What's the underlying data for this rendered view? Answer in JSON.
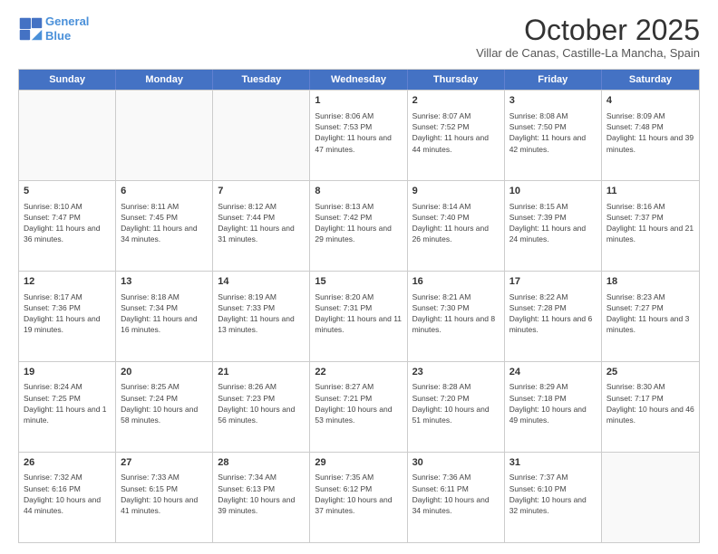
{
  "header": {
    "logo_line1": "General",
    "logo_line2": "Blue",
    "month_title": "October 2025",
    "location": "Villar de Canas, Castille-La Mancha, Spain"
  },
  "days_of_week": [
    "Sunday",
    "Monday",
    "Tuesday",
    "Wednesday",
    "Thursday",
    "Friday",
    "Saturday"
  ],
  "rows": [
    [
      {
        "day": "",
        "content": ""
      },
      {
        "day": "",
        "content": ""
      },
      {
        "day": "",
        "content": ""
      },
      {
        "day": "1",
        "content": "Sunrise: 8:06 AM\nSunset: 7:53 PM\nDaylight: 11 hours and 47 minutes."
      },
      {
        "day": "2",
        "content": "Sunrise: 8:07 AM\nSunset: 7:52 PM\nDaylight: 11 hours and 44 minutes."
      },
      {
        "day": "3",
        "content": "Sunrise: 8:08 AM\nSunset: 7:50 PM\nDaylight: 11 hours and 42 minutes."
      },
      {
        "day": "4",
        "content": "Sunrise: 8:09 AM\nSunset: 7:48 PM\nDaylight: 11 hours and 39 minutes."
      }
    ],
    [
      {
        "day": "5",
        "content": "Sunrise: 8:10 AM\nSunset: 7:47 PM\nDaylight: 11 hours and 36 minutes."
      },
      {
        "day": "6",
        "content": "Sunrise: 8:11 AM\nSunset: 7:45 PM\nDaylight: 11 hours and 34 minutes."
      },
      {
        "day": "7",
        "content": "Sunrise: 8:12 AM\nSunset: 7:44 PM\nDaylight: 11 hours and 31 minutes."
      },
      {
        "day": "8",
        "content": "Sunrise: 8:13 AM\nSunset: 7:42 PM\nDaylight: 11 hours and 29 minutes."
      },
      {
        "day": "9",
        "content": "Sunrise: 8:14 AM\nSunset: 7:40 PM\nDaylight: 11 hours and 26 minutes."
      },
      {
        "day": "10",
        "content": "Sunrise: 8:15 AM\nSunset: 7:39 PM\nDaylight: 11 hours and 24 minutes."
      },
      {
        "day": "11",
        "content": "Sunrise: 8:16 AM\nSunset: 7:37 PM\nDaylight: 11 hours and 21 minutes."
      }
    ],
    [
      {
        "day": "12",
        "content": "Sunrise: 8:17 AM\nSunset: 7:36 PM\nDaylight: 11 hours and 19 minutes."
      },
      {
        "day": "13",
        "content": "Sunrise: 8:18 AM\nSunset: 7:34 PM\nDaylight: 11 hours and 16 minutes."
      },
      {
        "day": "14",
        "content": "Sunrise: 8:19 AM\nSunset: 7:33 PM\nDaylight: 11 hours and 13 minutes."
      },
      {
        "day": "15",
        "content": "Sunrise: 8:20 AM\nSunset: 7:31 PM\nDaylight: 11 hours and 11 minutes."
      },
      {
        "day": "16",
        "content": "Sunrise: 8:21 AM\nSunset: 7:30 PM\nDaylight: 11 hours and 8 minutes."
      },
      {
        "day": "17",
        "content": "Sunrise: 8:22 AM\nSunset: 7:28 PM\nDaylight: 11 hours and 6 minutes."
      },
      {
        "day": "18",
        "content": "Sunrise: 8:23 AM\nSunset: 7:27 PM\nDaylight: 11 hours and 3 minutes."
      }
    ],
    [
      {
        "day": "19",
        "content": "Sunrise: 8:24 AM\nSunset: 7:25 PM\nDaylight: 11 hours and 1 minute."
      },
      {
        "day": "20",
        "content": "Sunrise: 8:25 AM\nSunset: 7:24 PM\nDaylight: 10 hours and 58 minutes."
      },
      {
        "day": "21",
        "content": "Sunrise: 8:26 AM\nSunset: 7:23 PM\nDaylight: 10 hours and 56 minutes."
      },
      {
        "day": "22",
        "content": "Sunrise: 8:27 AM\nSunset: 7:21 PM\nDaylight: 10 hours and 53 minutes."
      },
      {
        "day": "23",
        "content": "Sunrise: 8:28 AM\nSunset: 7:20 PM\nDaylight: 10 hours and 51 minutes."
      },
      {
        "day": "24",
        "content": "Sunrise: 8:29 AM\nSunset: 7:18 PM\nDaylight: 10 hours and 49 minutes."
      },
      {
        "day": "25",
        "content": "Sunrise: 8:30 AM\nSunset: 7:17 PM\nDaylight: 10 hours and 46 minutes."
      }
    ],
    [
      {
        "day": "26",
        "content": "Sunrise: 7:32 AM\nSunset: 6:16 PM\nDaylight: 10 hours and 44 minutes."
      },
      {
        "day": "27",
        "content": "Sunrise: 7:33 AM\nSunset: 6:15 PM\nDaylight: 10 hours and 41 minutes."
      },
      {
        "day": "28",
        "content": "Sunrise: 7:34 AM\nSunset: 6:13 PM\nDaylight: 10 hours and 39 minutes."
      },
      {
        "day": "29",
        "content": "Sunrise: 7:35 AM\nSunset: 6:12 PM\nDaylight: 10 hours and 37 minutes."
      },
      {
        "day": "30",
        "content": "Sunrise: 7:36 AM\nSunset: 6:11 PM\nDaylight: 10 hours and 34 minutes."
      },
      {
        "day": "31",
        "content": "Sunrise: 7:37 AM\nSunset: 6:10 PM\nDaylight: 10 hours and 32 minutes."
      },
      {
        "day": "",
        "content": ""
      }
    ]
  ]
}
